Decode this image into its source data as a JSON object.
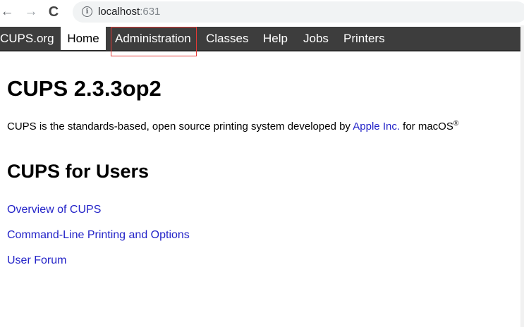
{
  "browser": {
    "back_glyph": "←",
    "forward_glyph": "→",
    "reload_glyph": "C",
    "info_glyph": "i",
    "url_host": "localhost",
    "url_port": ":631"
  },
  "nav": {
    "items": [
      {
        "label": "CUPS.org"
      },
      {
        "label": "Home"
      },
      {
        "label": "Administration"
      },
      {
        "label": "Classes"
      },
      {
        "label": "Help"
      },
      {
        "label": "Jobs"
      },
      {
        "label": "Printers"
      }
    ],
    "active": "Home",
    "highlighted": "Administration",
    "highlight_color": "#e53935"
  },
  "main": {
    "title": "CUPS 2.3.3op2",
    "intro_before": "CUPS is the standards-based, open source printing system developed by ",
    "intro_link": "Apple Inc.",
    "intro_after": " for macOS",
    "intro_sup": "®",
    "section_title": "CUPS for Users",
    "links": [
      {
        "label": "Overview of CUPS"
      },
      {
        "label": "Command-Line Printing and Options"
      },
      {
        "label": "User Forum"
      }
    ]
  },
  "colors": {
    "nav_bg": "#3d3d3d",
    "link": "#2323c8"
  }
}
